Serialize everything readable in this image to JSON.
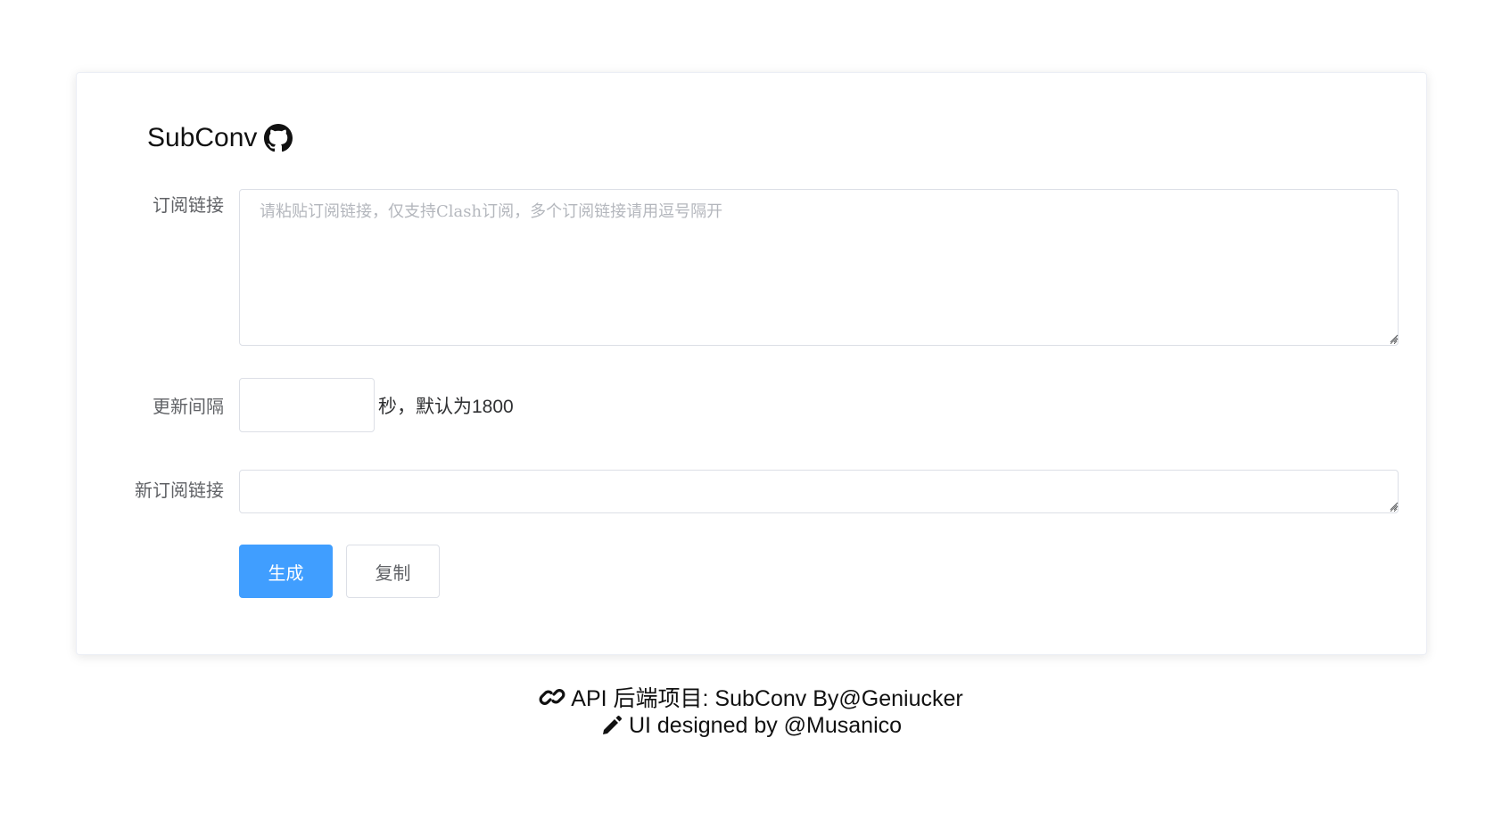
{
  "header": {
    "title": "SubConv",
    "github_icon": "github-icon"
  },
  "form": {
    "subscription": {
      "label": "订阅链接",
      "placeholder": "请粘贴订阅链接，仅支持Clash订阅，多个订阅链接请用逗号隔开",
      "value": ""
    },
    "interval": {
      "label": "更新间隔",
      "value": "",
      "suffix": "秒，默认为1800"
    },
    "new_subscription": {
      "label": "新订阅链接",
      "value": ""
    },
    "buttons": {
      "generate": "生成",
      "copy": "复制"
    }
  },
  "footer": {
    "api_line": "API 后端项目: SubConv By@Geniucker",
    "api_icon": "link-icon",
    "ui_line": "UI designed by @Musanico",
    "ui_icon": "pencil-icon"
  },
  "colors": {
    "primary": "#409eff",
    "border": "#dcdfe6",
    "label": "#606266",
    "placeholder": "#b4b7bd"
  }
}
